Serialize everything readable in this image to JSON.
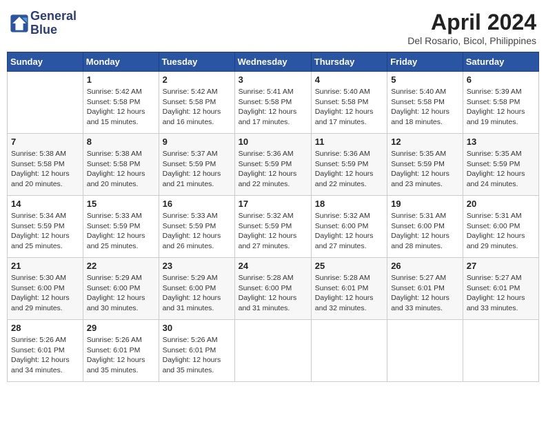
{
  "header": {
    "logo_line1": "General",
    "logo_line2": "Blue",
    "month": "April 2024",
    "location": "Del Rosario, Bicol, Philippines"
  },
  "weekdays": [
    "Sunday",
    "Monday",
    "Tuesday",
    "Wednesday",
    "Thursday",
    "Friday",
    "Saturday"
  ],
  "weeks": [
    [
      {
        "day": "",
        "info": ""
      },
      {
        "day": "1",
        "info": "Sunrise: 5:42 AM\nSunset: 5:58 PM\nDaylight: 12 hours\nand 15 minutes."
      },
      {
        "day": "2",
        "info": "Sunrise: 5:42 AM\nSunset: 5:58 PM\nDaylight: 12 hours\nand 16 minutes."
      },
      {
        "day": "3",
        "info": "Sunrise: 5:41 AM\nSunset: 5:58 PM\nDaylight: 12 hours\nand 17 minutes."
      },
      {
        "day": "4",
        "info": "Sunrise: 5:40 AM\nSunset: 5:58 PM\nDaylight: 12 hours\nand 17 minutes."
      },
      {
        "day": "5",
        "info": "Sunrise: 5:40 AM\nSunset: 5:58 PM\nDaylight: 12 hours\nand 18 minutes."
      },
      {
        "day": "6",
        "info": "Sunrise: 5:39 AM\nSunset: 5:58 PM\nDaylight: 12 hours\nand 19 minutes."
      }
    ],
    [
      {
        "day": "7",
        "info": "Sunrise: 5:38 AM\nSunset: 5:58 PM\nDaylight: 12 hours\nand 20 minutes."
      },
      {
        "day": "8",
        "info": "Sunrise: 5:38 AM\nSunset: 5:58 PM\nDaylight: 12 hours\nand 20 minutes."
      },
      {
        "day": "9",
        "info": "Sunrise: 5:37 AM\nSunset: 5:59 PM\nDaylight: 12 hours\nand 21 minutes."
      },
      {
        "day": "10",
        "info": "Sunrise: 5:36 AM\nSunset: 5:59 PM\nDaylight: 12 hours\nand 22 minutes."
      },
      {
        "day": "11",
        "info": "Sunrise: 5:36 AM\nSunset: 5:59 PM\nDaylight: 12 hours\nand 22 minutes."
      },
      {
        "day": "12",
        "info": "Sunrise: 5:35 AM\nSunset: 5:59 PM\nDaylight: 12 hours\nand 23 minutes."
      },
      {
        "day": "13",
        "info": "Sunrise: 5:35 AM\nSunset: 5:59 PM\nDaylight: 12 hours\nand 24 minutes."
      }
    ],
    [
      {
        "day": "14",
        "info": "Sunrise: 5:34 AM\nSunset: 5:59 PM\nDaylight: 12 hours\nand 25 minutes."
      },
      {
        "day": "15",
        "info": "Sunrise: 5:33 AM\nSunset: 5:59 PM\nDaylight: 12 hours\nand 25 minutes."
      },
      {
        "day": "16",
        "info": "Sunrise: 5:33 AM\nSunset: 5:59 PM\nDaylight: 12 hours\nand 26 minutes."
      },
      {
        "day": "17",
        "info": "Sunrise: 5:32 AM\nSunset: 5:59 PM\nDaylight: 12 hours\nand 27 minutes."
      },
      {
        "day": "18",
        "info": "Sunrise: 5:32 AM\nSunset: 6:00 PM\nDaylight: 12 hours\nand 27 minutes."
      },
      {
        "day": "19",
        "info": "Sunrise: 5:31 AM\nSunset: 6:00 PM\nDaylight: 12 hours\nand 28 minutes."
      },
      {
        "day": "20",
        "info": "Sunrise: 5:31 AM\nSunset: 6:00 PM\nDaylight: 12 hours\nand 29 minutes."
      }
    ],
    [
      {
        "day": "21",
        "info": "Sunrise: 5:30 AM\nSunset: 6:00 PM\nDaylight: 12 hours\nand 29 minutes."
      },
      {
        "day": "22",
        "info": "Sunrise: 5:29 AM\nSunset: 6:00 PM\nDaylight: 12 hours\nand 30 minutes."
      },
      {
        "day": "23",
        "info": "Sunrise: 5:29 AM\nSunset: 6:00 PM\nDaylight: 12 hours\nand 31 minutes."
      },
      {
        "day": "24",
        "info": "Sunrise: 5:28 AM\nSunset: 6:00 PM\nDaylight: 12 hours\nand 31 minutes."
      },
      {
        "day": "25",
        "info": "Sunrise: 5:28 AM\nSunset: 6:01 PM\nDaylight: 12 hours\nand 32 minutes."
      },
      {
        "day": "26",
        "info": "Sunrise: 5:27 AM\nSunset: 6:01 PM\nDaylight: 12 hours\nand 33 minutes."
      },
      {
        "day": "27",
        "info": "Sunrise: 5:27 AM\nSunset: 6:01 PM\nDaylight: 12 hours\nand 33 minutes."
      }
    ],
    [
      {
        "day": "28",
        "info": "Sunrise: 5:26 AM\nSunset: 6:01 PM\nDaylight: 12 hours\nand 34 minutes."
      },
      {
        "day": "29",
        "info": "Sunrise: 5:26 AM\nSunset: 6:01 PM\nDaylight: 12 hours\nand 35 minutes."
      },
      {
        "day": "30",
        "info": "Sunrise: 5:26 AM\nSunset: 6:01 PM\nDaylight: 12 hours\nand 35 minutes."
      },
      {
        "day": "",
        "info": ""
      },
      {
        "day": "",
        "info": ""
      },
      {
        "day": "",
        "info": ""
      },
      {
        "day": "",
        "info": ""
      }
    ]
  ]
}
